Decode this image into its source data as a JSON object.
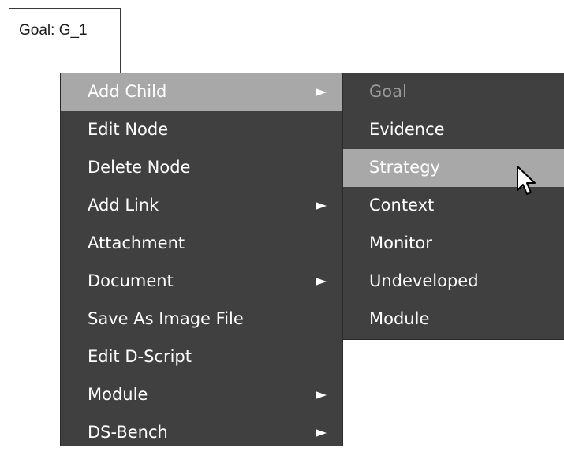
{
  "goal_node": {
    "label": "Goal: G_1"
  },
  "context_menu": {
    "items": [
      {
        "label": "Add Child",
        "has_submenu": true,
        "highlighted": true
      },
      {
        "label": "Edit Node",
        "has_submenu": false
      },
      {
        "label": "Delete Node",
        "has_submenu": false
      },
      {
        "label": "Add Link",
        "has_submenu": true
      },
      {
        "label": "Attachment",
        "has_submenu": false
      },
      {
        "label": "Document",
        "has_submenu": true
      },
      {
        "label": "Save As Image File",
        "has_submenu": false
      },
      {
        "label": "Edit D-Script",
        "has_submenu": false
      },
      {
        "label": "Module",
        "has_submenu": true
      },
      {
        "label": "DS-Bench",
        "has_submenu": true
      }
    ]
  },
  "submenu": {
    "items": [
      {
        "label": "Goal",
        "disabled": true
      },
      {
        "label": "Evidence"
      },
      {
        "label": "Strategy",
        "highlighted": true
      },
      {
        "label": "Context"
      },
      {
        "label": "Monitor"
      },
      {
        "label": "Undeveloped"
      },
      {
        "label": "Module"
      }
    ]
  },
  "colors": {
    "menu_background": "#404040",
    "highlight": "#a8a8a8",
    "menu_text": "#ffffff",
    "disabled_text": "#9a9a9a"
  },
  "cursor": {
    "icon": "mouse-pointer-icon"
  }
}
